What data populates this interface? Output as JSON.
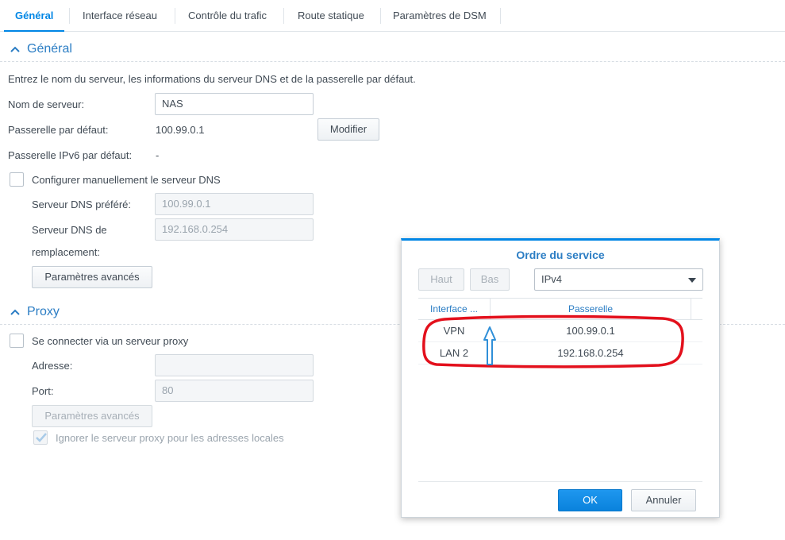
{
  "tabs": [
    {
      "label": "Général",
      "active": true
    },
    {
      "label": "Interface réseau"
    },
    {
      "label": "Contrôle du trafic"
    },
    {
      "label": "Route statique"
    },
    {
      "label": "Paramètres de DSM"
    }
  ],
  "general": {
    "section_title": "Général",
    "description": "Entrez le nom du serveur, les informations du serveur DNS et de la passerelle par défaut.",
    "server_name_label": "Nom de serveur:",
    "server_name_value": "NAS",
    "default_gateway_label": "Passerelle par défaut:",
    "default_gateway_value": "100.99.0.1",
    "modify_button": "Modifier",
    "ipv6_gateway_label": "Passerelle IPv6 par défaut:",
    "ipv6_gateway_value": "-",
    "manual_dns_label": "Configurer manuellement le serveur DNS",
    "preferred_dns_label": "Serveur DNS préféré:",
    "preferred_dns_value": "100.99.0.1",
    "alternate_dns_label_1": "Serveur DNS de",
    "alternate_dns_label_2": "remplacement:",
    "alternate_dns_value": "192.168.0.254",
    "advanced_button": "Paramètres avancés"
  },
  "proxy": {
    "section_title": "Proxy",
    "connect_label": "Se connecter via un serveur proxy",
    "address_label": "Adresse:",
    "address_value": "",
    "port_label": "Port:",
    "port_value": "80",
    "advanced_button": "Paramètres avancés",
    "bypass_local_label": "Ignorer le serveur proxy pour les adresses locales"
  },
  "dialog": {
    "title": "Ordre du service",
    "up_button": "Haut",
    "down_button": "Bas",
    "protocol_select": "IPv4",
    "columns": [
      "Interface ...",
      "Passerelle"
    ],
    "rows": [
      {
        "interface": "VPN",
        "gateway": "100.99.0.1"
      },
      {
        "interface": "LAN 2",
        "gateway": "192.168.0.254"
      }
    ],
    "ok_button": "OK",
    "cancel_button": "Annuler"
  },
  "colors": {
    "accent": "#0086e5",
    "section_title": "#2b7dc4",
    "annotation_red": "#e3101c",
    "annotation_arrow": "#2f8fd8"
  }
}
